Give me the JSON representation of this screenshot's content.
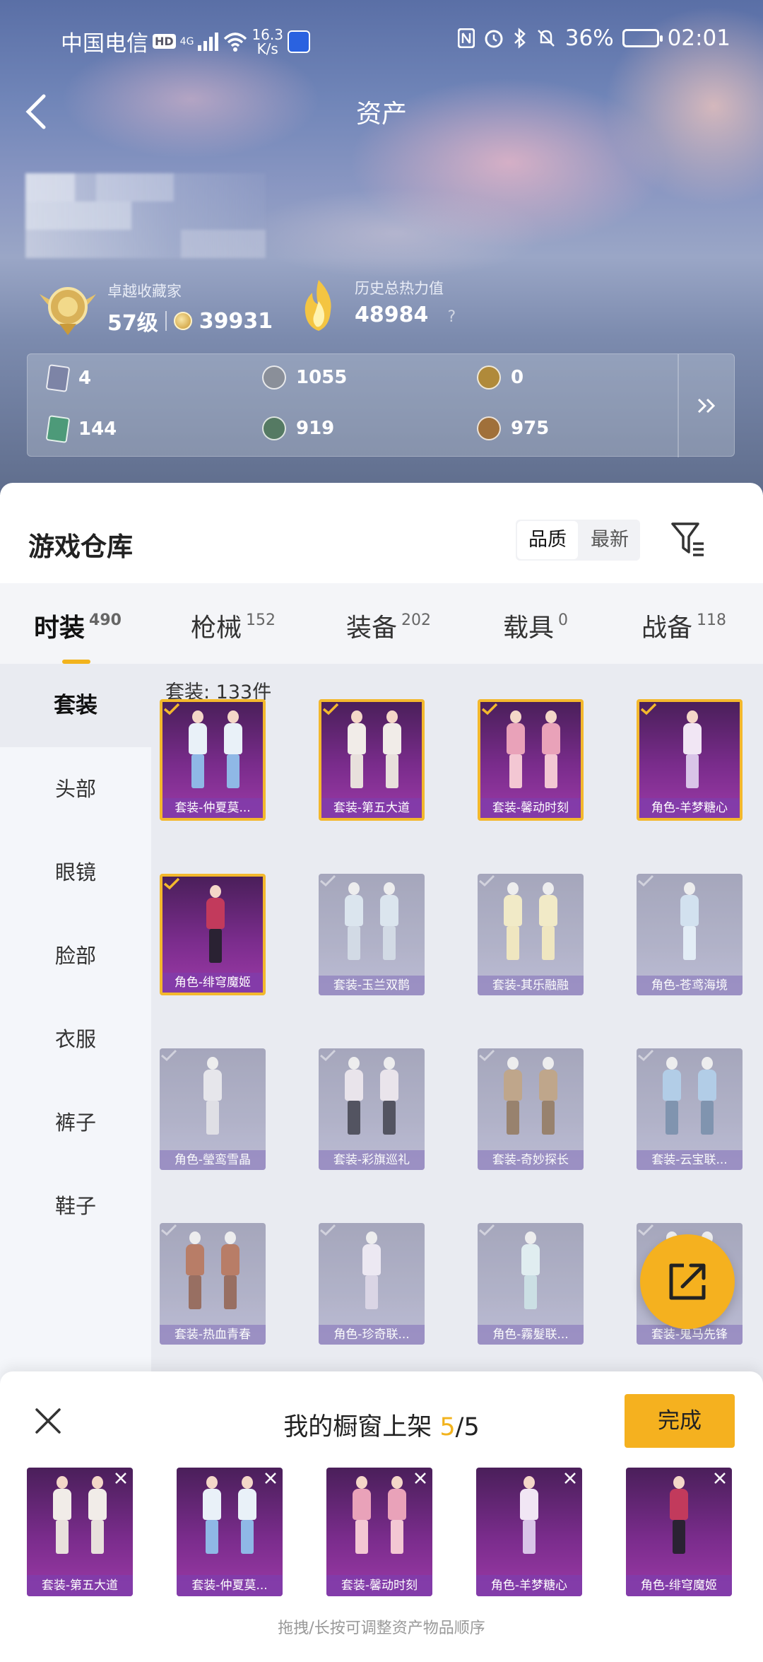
{
  "status_bar": {
    "carrier": "中国电信",
    "hd": "HD",
    "network": "4G",
    "speed_value": "16.3",
    "speed_unit": "K/s",
    "battery": "36%",
    "time": "02:01"
  },
  "nav": {
    "title": "资产"
  },
  "profile": {
    "collector_label": "卓越收藏家",
    "level": "57级",
    "collection_points": "39931",
    "heat_label": "历史总热力值",
    "heat_value": "48984",
    "heat_help": "?"
  },
  "assets": [
    {
      "icon": "card-icon",
      "value": "4"
    },
    {
      "icon": "silver-coin-icon",
      "value": "1055"
    },
    {
      "icon": "gold-token-icon",
      "value": "0"
    },
    {
      "icon": "green-card-icon",
      "value": "144"
    },
    {
      "icon": "gem-orb-icon",
      "value": "919"
    },
    {
      "icon": "bronze-coin-icon",
      "value": "975"
    }
  ],
  "warehouse": {
    "title": "游戏仓库",
    "sort_options": [
      "品质",
      "最新"
    ],
    "sort_selected": "品质"
  },
  "categories": [
    {
      "label": "时装",
      "count": "490"
    },
    {
      "label": "枪械",
      "count": "152"
    },
    {
      "label": "装备",
      "count": "202"
    },
    {
      "label": "载具",
      "count": "0"
    },
    {
      "label": "战备",
      "count": "118"
    }
  ],
  "sub_categories": [
    "套装",
    "头部",
    "眼镜",
    "脸部",
    "衣服",
    "裤子",
    "鞋子"
  ],
  "grid": {
    "count_label": "套装: 133件",
    "items": [
      {
        "name": "套装-仲夏莫...",
        "owned": true
      },
      {
        "name": "套装-第五大道",
        "owned": true
      },
      {
        "name": "套装-馨动时刻",
        "owned": true
      },
      {
        "name": "角色-羊梦糖心",
        "owned": true
      },
      {
        "name": "角色-绯穹魔姬",
        "owned": true
      },
      {
        "name": "套装-玉兰双鹊",
        "owned": false
      },
      {
        "name": "套装-其乐融融",
        "owned": false
      },
      {
        "name": "角色-苍鸢海境",
        "owned": false
      },
      {
        "name": "角色-瑩鸾雪晶",
        "owned": false
      },
      {
        "name": "套装-彩旗巡礼",
        "owned": false
      },
      {
        "name": "套装-奇妙探长",
        "owned": false
      },
      {
        "name": "套装-云宝联...",
        "owned": false
      },
      {
        "name": "套装-热血青春",
        "owned": false
      },
      {
        "name": "角色-珍奇联...",
        "owned": false
      },
      {
        "name": "角色-霧髮联...",
        "owned": false
      },
      {
        "name": "套装-鬼马先锋",
        "owned": false
      }
    ]
  },
  "showcase": {
    "title_prefix": "我的橱窗上架 ",
    "current": "5",
    "total": "/5",
    "done_label": "完成",
    "items": [
      "套装-第五大道",
      "套装-仲夏莫...",
      "套装-馨动时刻",
      "角色-羊梦糖心",
      "角色-绯穹魔姬"
    ],
    "hint": "拖拽/长按可调整资产物品顺序"
  },
  "colors": {
    "accent": "#f5b11f",
    "owned_bg": "#7a2c8c",
    "locked_bg": "#a8a9c2"
  }
}
